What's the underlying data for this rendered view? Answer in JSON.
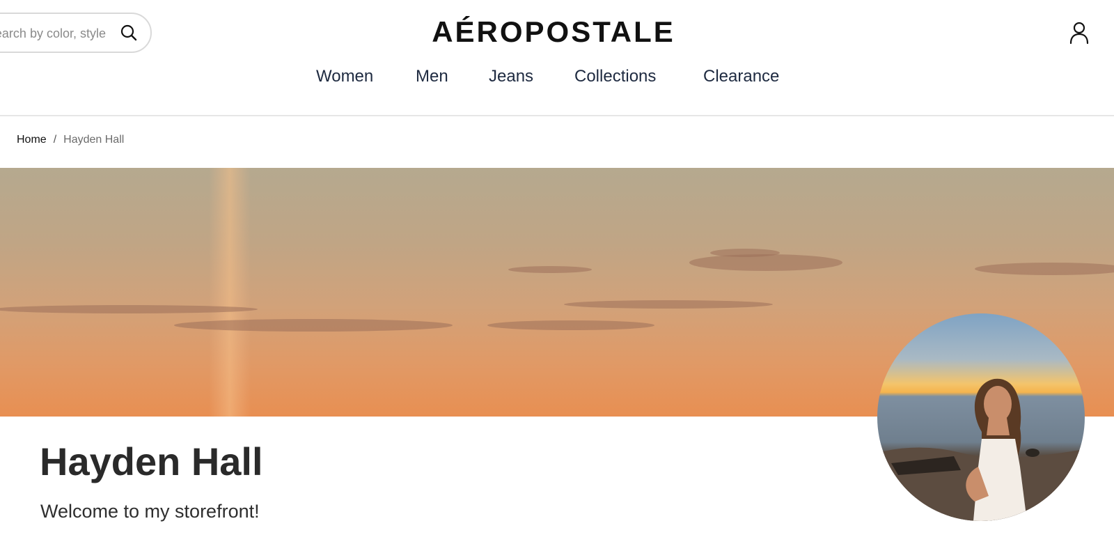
{
  "header": {
    "search": {
      "placeholder": "Search by color, style"
    },
    "logo_text": "AÉROPOSTALE",
    "nav": [
      {
        "label": "Women"
      },
      {
        "label": "Men"
      },
      {
        "label": "Jeans"
      },
      {
        "label": "Collections"
      },
      {
        "label": "Clearance"
      }
    ]
  },
  "breadcrumb": {
    "home": "Home",
    "separator": "/",
    "current": "Hayden Hall"
  },
  "profile": {
    "name": "Hayden Hall",
    "tagline": "Welcome to my storefront!"
  },
  "colors": {
    "nav_text": "#1e2a40",
    "banner_top": "#b5a98f",
    "banner_bottom": "#e88f52"
  },
  "icons": {
    "search": "search-icon",
    "account": "account-icon"
  }
}
